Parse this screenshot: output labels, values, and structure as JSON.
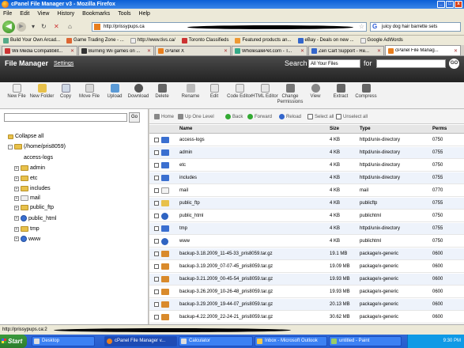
{
  "window": {
    "title": "cPanel File Manager v3 - Mozilla Firefox"
  },
  "menu": [
    "File",
    "Edit",
    "View",
    "History",
    "Bookmarks",
    "Tools",
    "Help"
  ],
  "nav": {
    "url": "http://prissypups.ca",
    "search_text": "juicy dog hair barrette sets"
  },
  "bookmarks": [
    "Build Your Own Arcad...",
    "Game Trading Zone - ...",
    "http://www.tivs.ca/",
    "Toronto Classifieds",
    "Featured products an...",
    "eBay - Deals on new ...",
    "Google AdWords"
  ],
  "tabs": [
    "Wii Media Compatibilit...",
    "Burning Wii games on ...",
    "cPanel X",
    "WholesalePet.com - T...",
    "Zen Cart Support - Re...",
    "cPanel File Manag..."
  ],
  "cpanel": {
    "title": "File Manager",
    "settings": "Settings",
    "search_label": "Search",
    "search_scope": "All Your Files",
    "for_label": "for",
    "go_label": "GO"
  },
  "toolbar": [
    "New File",
    "New Folder",
    "Copy",
    "Move File",
    "Upload",
    "Download",
    "Delete",
    "Rename",
    "Edit",
    "Code Editor",
    "HTML Editor",
    "Change Permissions",
    "View",
    "Extract",
    "Compress"
  ],
  "tree": {
    "go_label": "Go",
    "collapse_all": "Collapse all",
    "root": "(/home/pris8059)",
    "items": [
      "access-logs",
      "admin",
      "etc",
      "includes",
      "mail",
      "public_ftp",
      "public_html",
      "tmp",
      "www"
    ]
  },
  "actions": [
    "Home",
    "Up One Level",
    "Back",
    "Forward",
    "Reload",
    "Select all",
    "Unselect all"
  ],
  "grid": {
    "headers": [
      "Name",
      "Size",
      "Type",
      "Perms"
    ],
    "rows": [
      {
        "name": "access-logs",
        "size": "4 KB",
        "type": "httpd/unix-directory",
        "perms": "0750",
        "icon": "folder-icon"
      },
      {
        "name": "admin",
        "size": "4 KB",
        "type": "httpd/unix-directory",
        "perms": "0755",
        "icon": "folder-icon"
      },
      {
        "name": "etc",
        "size": "4 KB",
        "type": "httpd/unix-directory",
        "perms": "0750",
        "icon": "folder-icon"
      },
      {
        "name": "includes",
        "size": "4 KB",
        "type": "httpd/unix-directory",
        "perms": "0755",
        "icon": "folder-icon"
      },
      {
        "name": "mail",
        "size": "4 KB",
        "type": "mail",
        "perms": "0770",
        "icon": "mail-icon"
      },
      {
        "name": "public_ftp",
        "size": "4 KB",
        "type": "publicftp",
        "perms": "0755",
        "icon": "ftp-icon"
      },
      {
        "name": "public_html",
        "size": "4 KB",
        "type": "publichtml",
        "perms": "0750",
        "icon": "globe-icon"
      },
      {
        "name": "tmp",
        "size": "4 KB",
        "type": "httpd/unix-directory",
        "perms": "0755",
        "icon": "folder-icon"
      },
      {
        "name": "www",
        "size": "4 KB",
        "type": "publichtml",
        "perms": "0750",
        "icon": "globe-icon"
      },
      {
        "name": "backup-3.18.2009_11-45-33_pris8059.tar.gz",
        "size": "19.1 MB",
        "type": "package/x-generic",
        "perms": "0600",
        "icon": "package-icon"
      },
      {
        "name": "backup-3.19.2009_07-07-45_pris8059.tar.gz",
        "size": "19.09 MB",
        "type": "package/x-generic",
        "perms": "0600",
        "icon": "package-icon"
      },
      {
        "name": "backup-3.21.2009_00-45-54_pris8059.tar.gz",
        "size": "19.93 MB",
        "type": "package/x-generic",
        "perms": "0600",
        "icon": "package-icon"
      },
      {
        "name": "backup-3.26.2009_10-26-48_pris8059.tar.gz",
        "size": "19.93 MB",
        "type": "package/x-generic",
        "perms": "0600",
        "icon": "package-icon"
      },
      {
        "name": "backup-3.29.2009_19-44-07_pris8059.tar.gz",
        "size": "20.13 MB",
        "type": "package/x-generic",
        "perms": "0600",
        "icon": "package-icon"
      },
      {
        "name": "backup-4.22.2009_22-24-21_pris8059.tar.gz",
        "size": "30.62 MB",
        "type": "package/x-generic",
        "perms": "0600",
        "icon": "package-icon"
      }
    ]
  },
  "status": {
    "text": "http://prissypups.ca:2"
  },
  "taskbar": {
    "start": "Start",
    "tasks": [
      "Desktop",
      "cPanel File Manager v...",
      "Calculator",
      "Inbox - Microsoft Outlook",
      "untitled - Paint"
    ],
    "clock": "9:30 PM"
  }
}
